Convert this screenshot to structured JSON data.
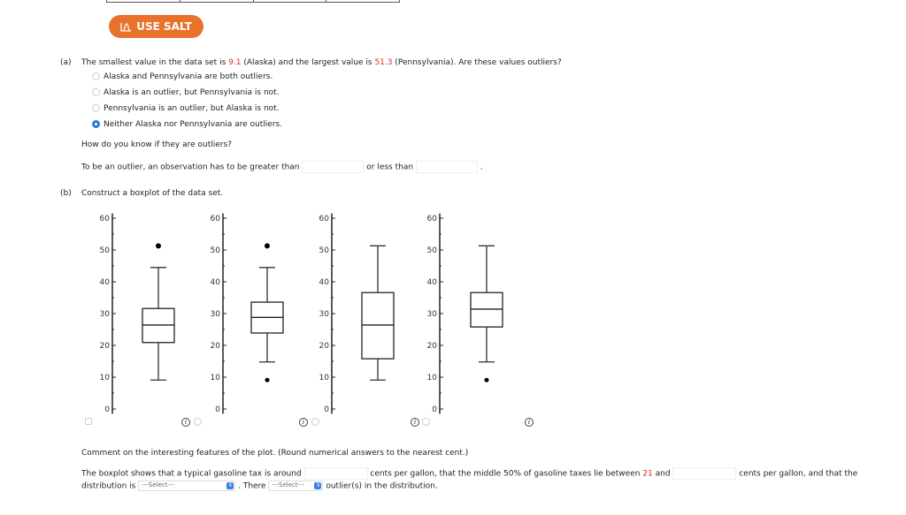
{
  "salt_button": "USE SALT",
  "part_a": {
    "label": "(a)",
    "q_pre": "The smallest value in the data set is ",
    "min_val": "9.1",
    "q_mid1": " (Alaska) and the largest value is ",
    "max_val": "51.3",
    "q_post": " (Pennsylvania). Are these values outliers?",
    "options": [
      {
        "label": "Alaska and Pennsylvania are both outliers.",
        "selected": false
      },
      {
        "label": "Alaska is an outlier, but Pennsylvania is not.",
        "selected": false
      },
      {
        "label": "Pennsylvania is an outlier, but Alaska is not.",
        "selected": false
      },
      {
        "label": "Neither Alaska nor Pennsylvania are outliers.",
        "selected": true
      }
    ],
    "how": "How do you know if they are outliers?",
    "rule_pre": "To be an outlier, an observation has to be greater than",
    "rule_mid": "or less than",
    "rule_end": ".",
    "upper_value": "",
    "lower_value": ""
  },
  "part_b": {
    "label": "(b)",
    "prompt": "Construct a boxplot of the data set.",
    "comment": "Comment on the interesting features of the plot. (Round numerical answers to the nearest cent.)",
    "s1": "The boxplot shows that a typical gasoline tax is around",
    "s2": "cents per gallon, that the middle 50% of gasoline taxes lie between",
    "q1_val": "21",
    "s3": "and",
    "s4": "cents per gallon, and that the",
    "s5": "distribution is",
    "select1": "---Select---",
    "s6": ". There",
    "select2": "---Select---",
    "s7": "outlier(s) in the distribution.",
    "typical_value": "",
    "q3_value": ""
  },
  "chart_data": [
    {
      "type": "boxplot",
      "ylim": [
        0,
        60
      ],
      "yticks": [
        "0",
        "10",
        "20",
        "30",
        "40",
        "50",
        "60"
      ],
      "min": 9.1,
      "q1": 20.9,
      "median": 26.4,
      "q3": 31.6,
      "max": 44.5,
      "outliers": [
        51.3
      ],
      "selected": false
    },
    {
      "type": "boxplot",
      "ylim": [
        0,
        60
      ],
      "yticks": [
        "0",
        "10",
        "20",
        "30",
        "40",
        "50",
        "60"
      ],
      "min": 14.8,
      "q1": 23.9,
      "median": 28.8,
      "q3": 33.6,
      "max": 44.5,
      "outliers": [
        51.3,
        9.1
      ],
      "selected": false
    },
    {
      "type": "boxplot",
      "ylim": [
        0,
        60
      ],
      "yticks": [
        "0",
        "10",
        "20",
        "30",
        "40",
        "50",
        "60"
      ],
      "min": 9.1,
      "q1": 15.8,
      "median": 26.4,
      "q3": 36.6,
      "max": 51.3,
      "outliers": [],
      "selected": false
    },
    {
      "type": "boxplot",
      "ylim": [
        0,
        60
      ],
      "yticks": [
        "0",
        "10",
        "20",
        "30",
        "40",
        "50",
        "60"
      ],
      "min": 14.8,
      "q1": 25.8,
      "median": 31.4,
      "q3": 36.6,
      "max": 51.3,
      "outliers": [
        9.1
      ],
      "selected": false
    }
  ]
}
